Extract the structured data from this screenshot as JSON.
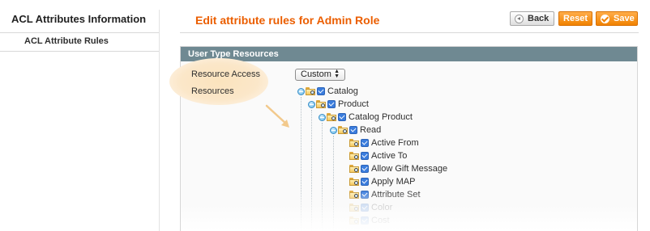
{
  "sidebar": {
    "title": "ACL Attributes Information",
    "items": [
      {
        "label": "ACL Attribute Rules"
      }
    ]
  },
  "header": {
    "title": "Edit attribute rules for Admin Role",
    "buttons": {
      "back": "Back",
      "reset": "Reset",
      "save": "Save"
    }
  },
  "fieldset": {
    "title": "User Type Resources",
    "resource_access_label": "Resource Access",
    "resource_access_value": "Custom",
    "resources_label": "Resources"
  },
  "tree": [
    {
      "label": "Catalog",
      "checked": true
    },
    {
      "label": "Product",
      "checked": true
    },
    {
      "label": "Catalog Product",
      "checked": true
    },
    {
      "label": "Read",
      "checked": true
    },
    {
      "label": "Active From",
      "checked": true
    },
    {
      "label": "Active To",
      "checked": true
    },
    {
      "label": "Allow Gift Message",
      "checked": true
    },
    {
      "label": "Apply MAP",
      "checked": true
    },
    {
      "label": "Attribute Set",
      "checked": true
    },
    {
      "label": "Color",
      "checked": true
    },
    {
      "label": "Cost",
      "checked": true
    }
  ],
  "colors": {
    "accent": "#eb5e00",
    "button_orange": "#f18200",
    "fieldset_header": "#6f8992",
    "checkbox": "#3b7ddd"
  }
}
